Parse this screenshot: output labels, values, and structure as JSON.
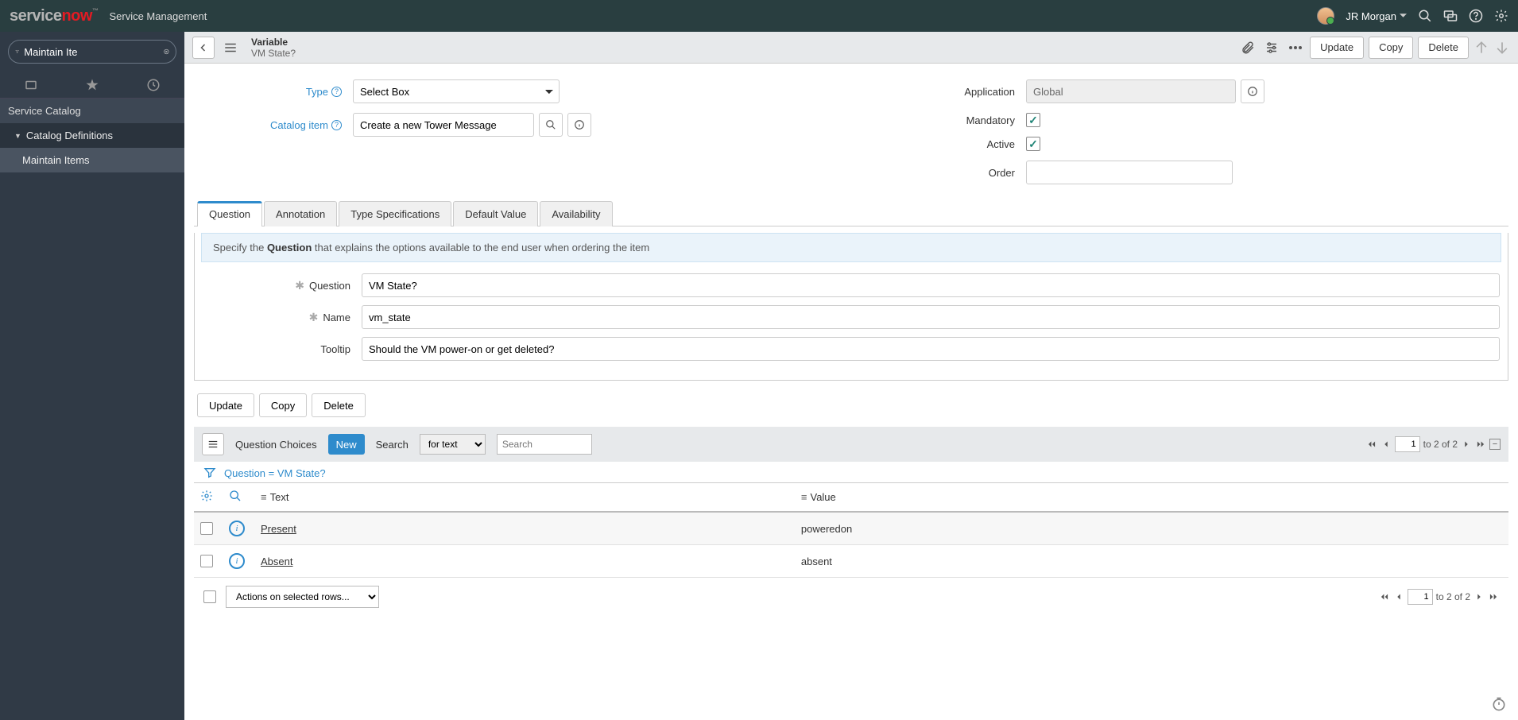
{
  "banner": {
    "product_title": "Service Management",
    "user_name": "JR Morgan"
  },
  "sidebar": {
    "filter_value": "Maintain Ite",
    "section": "Service Catalog",
    "group": "Catalog Definitions",
    "item": "Maintain Items"
  },
  "header": {
    "record_type": "Variable",
    "record_display": "VM State?",
    "actions": {
      "update": "Update",
      "copy": "Copy",
      "delete": "Delete"
    }
  },
  "form": {
    "type_label": "Type",
    "type_value": "Select Box",
    "catalog_item_label": "Catalog item",
    "catalog_item_value": "Create a new Tower Message",
    "application_label": "Application",
    "application_value": "Global",
    "mandatory_label": "Mandatory",
    "active_label": "Active",
    "order_label": "Order",
    "order_value": ""
  },
  "tabs": {
    "question": "Question",
    "annotation": "Annotation",
    "typespec": "Type Specifications",
    "default": "Default Value",
    "availability": "Availability"
  },
  "tab_info_prefix": "Specify the ",
  "tab_info_bold": "Question",
  "tab_info_suffix": " that explains the options available to the end user when ordering the item",
  "question": {
    "question_label": "Question",
    "question_value": "VM State?",
    "name_label": "Name",
    "name_value": "vm_state",
    "tooltip_label": "Tooltip",
    "tooltip_value": "Should the VM power-on or get deleted?"
  },
  "buttons": {
    "update": "Update",
    "copy": "Copy",
    "delete": "Delete"
  },
  "choices": {
    "title": "Question Choices",
    "new": "New",
    "search_label": "Search",
    "search_mode": "for text",
    "search_placeholder": "Search",
    "page_current": "1",
    "page_text": "to 2 of 2",
    "filter_text": "Question = VM State?",
    "col_text": "Text",
    "col_value": "Value",
    "rows": [
      {
        "text": "Present",
        "value": "poweredon"
      },
      {
        "text": "Absent",
        "value": "absent"
      }
    ],
    "actions_placeholder": "Actions on selected rows...",
    "page2_current": "1",
    "page2_text": "to 2 of 2"
  }
}
